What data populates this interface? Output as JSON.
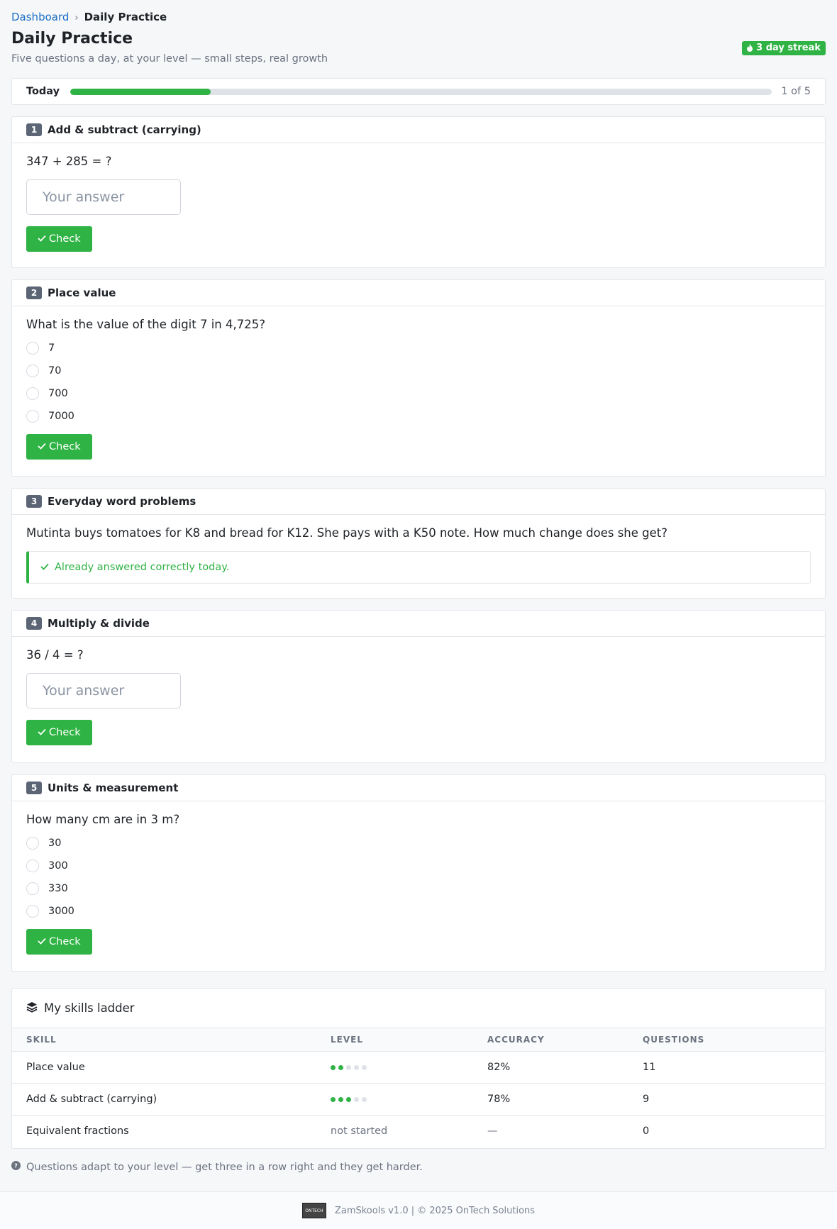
{
  "breadcrumb": {
    "home": "Dashboard",
    "current": "Daily Practice"
  },
  "page": {
    "title": "Daily Practice",
    "subtitle": "Five questions a day, at your level — small steps, real growth",
    "streak": "3 day streak"
  },
  "progress": {
    "label": "Today",
    "count": "1 of 5",
    "fraction": 0.2
  },
  "answer_placeholder": "Your answer",
  "check_label": "Check",
  "questions": [
    {
      "num": "1",
      "title": "Add & subtract (carrying)",
      "text": "347 + 285 = ?"
    },
    {
      "num": "2",
      "title": "Place value",
      "text": "What is the value of the digit 7 in 4,725?",
      "options": [
        "7",
        "70",
        "700",
        "7000"
      ]
    },
    {
      "num": "3",
      "title": "Everyday word problems",
      "text": "Mutinta buys tomatoes for K8 and bread for K12. She pays with a K50 note. How much change does she get?",
      "status": "Already answered correctly today."
    },
    {
      "num": "4",
      "title": "Multiply & divide",
      "text": "36 / 4 = ?"
    },
    {
      "num": "5",
      "title": "Units & measurement",
      "text": "How many cm are in 3 m?",
      "options": [
        "30",
        "300",
        "330",
        "3000"
      ]
    }
  ],
  "skills": {
    "title": "My skills ladder",
    "headers": [
      "SKILL",
      "LEVEL",
      "ACCURACY",
      "QUESTIONS"
    ],
    "rows": [
      {
        "skill": "Place value",
        "level": 2,
        "level_max": 5,
        "accuracy": "82%",
        "questions": "11"
      },
      {
        "skill": "Add & subtract (carrying)",
        "level": 3,
        "level_max": 5,
        "accuracy": "78%",
        "questions": "9"
      },
      {
        "skill": "Equivalent fractions",
        "level_text": "not started",
        "accuracy": "—",
        "questions": "0"
      }
    ]
  },
  "hint": "Questions adapt to your level — get three in a row right and they get harder.",
  "footer": {
    "logo_text": "ONTECH",
    "text": "ZamSkools v1.0 | © 2025 OnTech Solutions"
  },
  "colors": {
    "accent": "#2fb344",
    "link": "#1a6fc4",
    "badge": "#5b6575"
  }
}
